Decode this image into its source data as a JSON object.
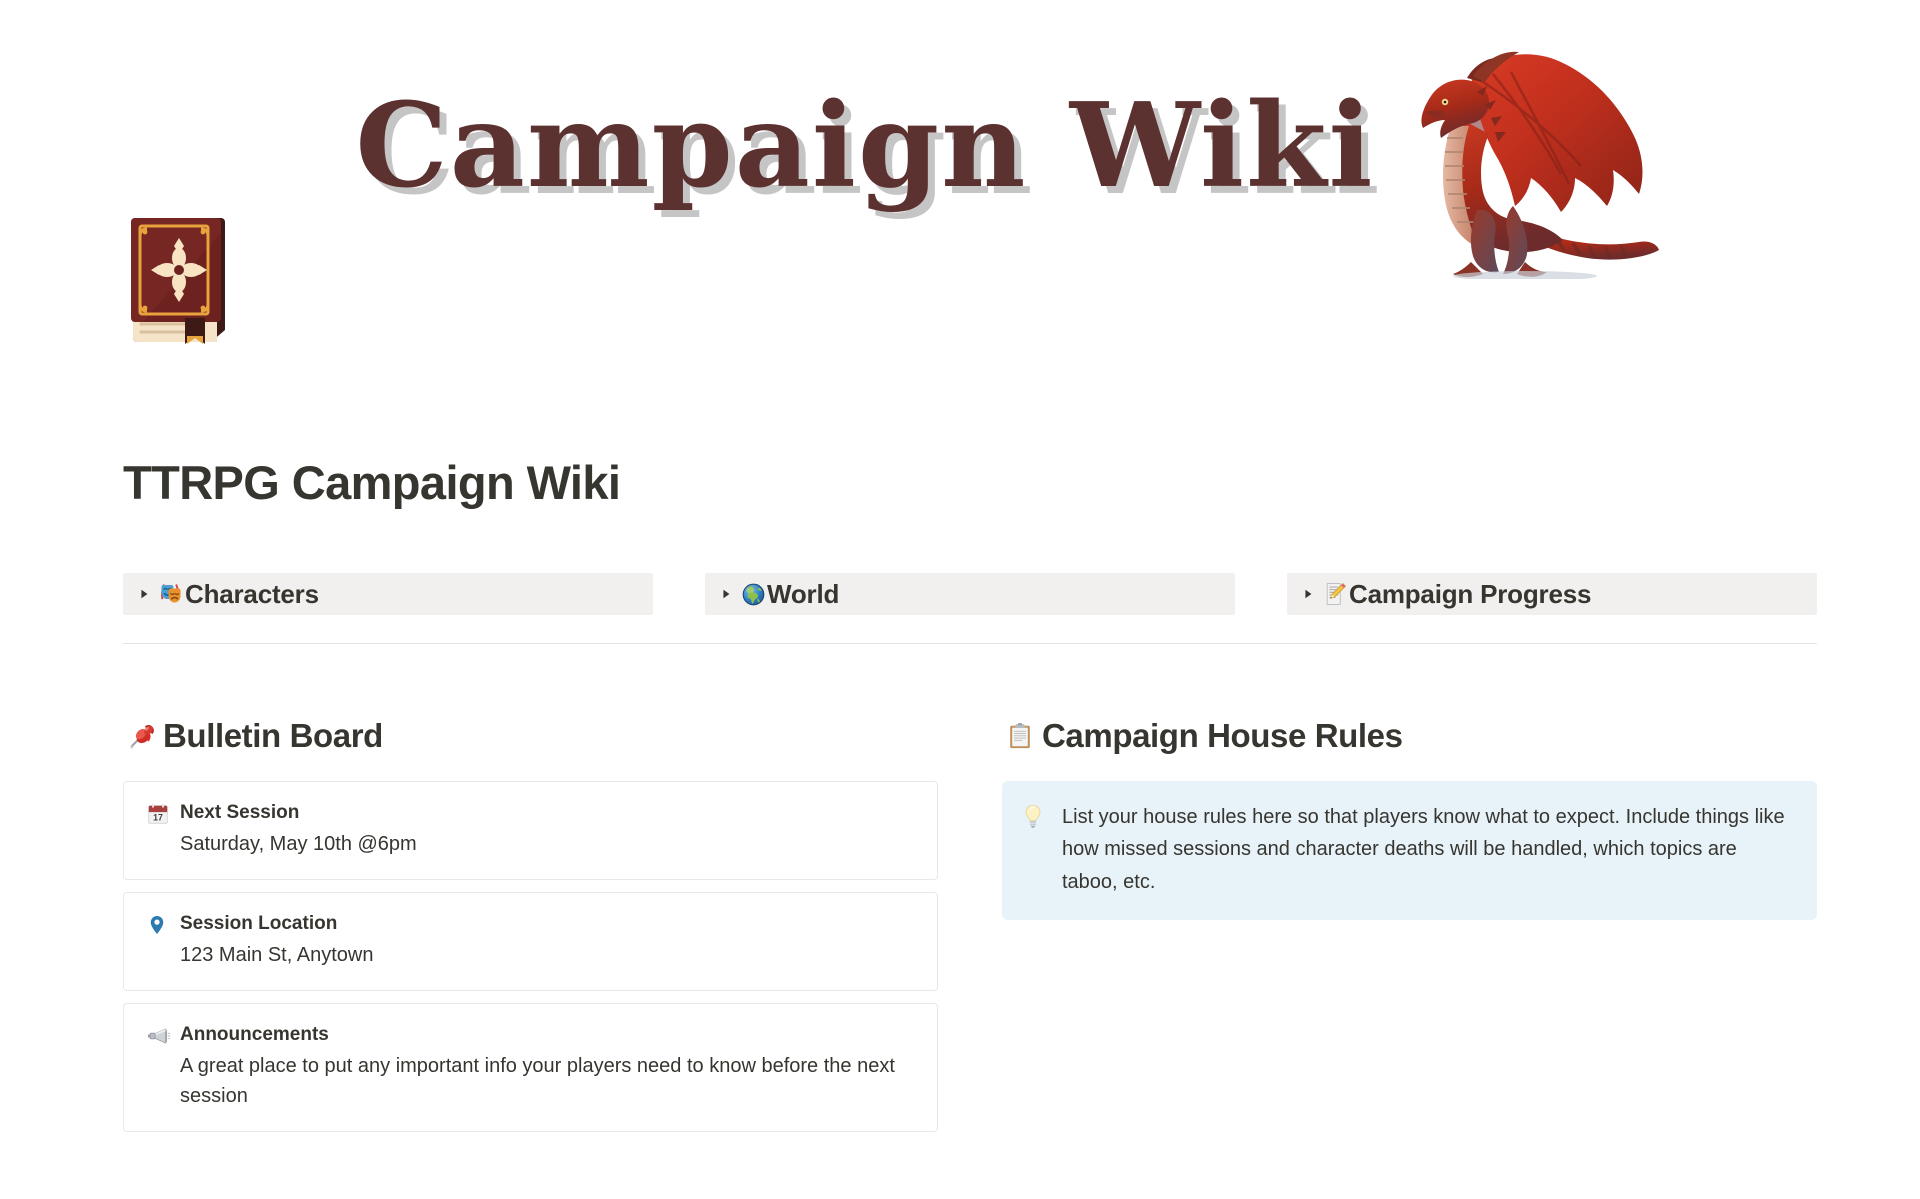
{
  "cover": {
    "banner_text": "Campaign Wiki",
    "banner_color": "#5c3230",
    "banner_shadow_color": "#969696",
    "dragon_icon": "red-dragon-illustration"
  },
  "page": {
    "icon": "closed-book-icon",
    "title": "TTRPG Campaign Wiki"
  },
  "toggles": [
    {
      "arrow": "triangle-right-icon",
      "emoji": "performing-arts-masks-emoji",
      "label": "Characters"
    },
    {
      "arrow": "triangle-right-icon",
      "emoji": "globe-americas-emoji",
      "label": "World"
    },
    {
      "arrow": "triangle-right-icon",
      "emoji": "memo-pencil-emoji",
      "label": "Campaign Progress"
    }
  ],
  "bulletin": {
    "emoji": "pushpin-emoji",
    "heading": "Bulletin Board",
    "cards": [
      {
        "icon": "calendar-emoji",
        "calendar_day": "17",
        "title": "Next Session",
        "text": "Saturday, May 10th @6pm"
      },
      {
        "icon": "location-pin-icon",
        "title": "Session Location",
        "text": "123 Main St, Anytown"
      },
      {
        "icon": "loudspeaker-emoji",
        "title": "Announcements",
        "text": "A great place to put any important info your players need to know before the next session"
      }
    ]
  },
  "house_rules": {
    "emoji": "clipboard-emoji",
    "heading": "Campaign House Rules",
    "callout": {
      "icon": "light-bulb-emoji",
      "background": "#e7f3f8",
      "text": "List your house rules here so that players know what to expect. Include things like how missed sessions and character deaths will be handled, which topics are taboo, etc."
    }
  }
}
